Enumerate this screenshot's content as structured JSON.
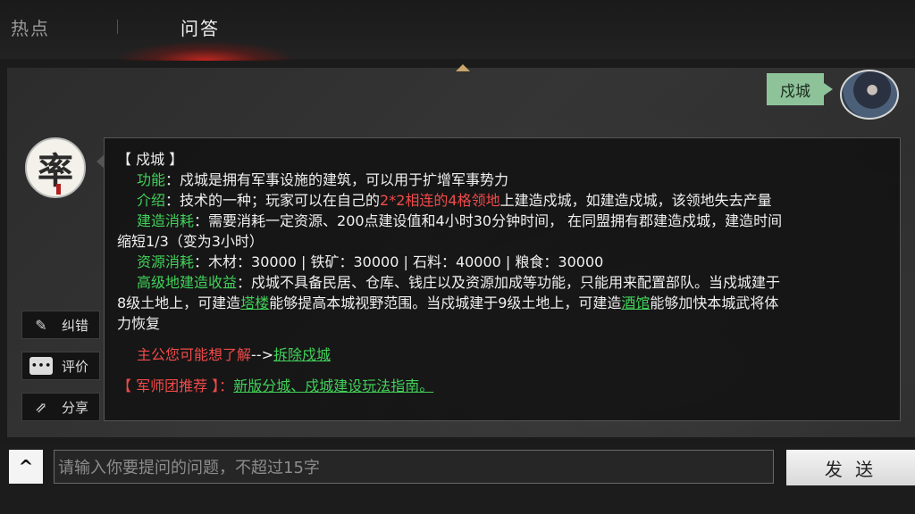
{
  "tabs": {
    "hot": "热点",
    "qa": "问答"
  },
  "question": {
    "text": "戍城"
  },
  "bot": {
    "avatar_char": "率"
  },
  "side_buttons": {
    "fix": "纠错",
    "rate": "评价",
    "share": "分享"
  },
  "answer": {
    "title": "【 戍城 】",
    "func_label": "功能",
    "func_text": "：戍城是拥有军事设施的建筑，可以用于扩增军事势力",
    "intro_label": "介绍",
    "intro_a": "：技术的一种；玩家可以在自己的",
    "intro_red": "2*2相连的4格领地",
    "intro_b": "上建造戍城，如建造戍城，该领地失去产量",
    "build_label": "建造消耗",
    "build_text": "：需要消耗一定资源、200点建设值和4小时30分钟时间，  在同盟拥有郡建造戍城，建造时间",
    "build_text2": "缩短1/3（变为3小时）",
    "res_label": "资源消耗",
    "res_text": "：木材：30000 | 铁矿：30000 | 石料：40000 | 粮食：30000",
    "adv_label": "高级地建造收益",
    "adv_text": "：戍城不具备民居、仓库、钱庄以及资源加成等功能，只能用来配置部队。当戍城建于",
    "adv_line2_a": "8级土地上，可建造",
    "adv_link1": "塔楼",
    "adv_line2_b": "能够提高本城视野范围。当戍城建于9级土地上，可建造",
    "adv_link2": "酒馆",
    "adv_line2_c": "能够加快本城武将体",
    "adv_line3": "力恢复",
    "related_prefix": "主公您可能想了解",
    "related_arrow": "-->",
    "related_link": "拆除戍城",
    "rec_prefix": "【 军师团推荐 】：",
    "rec_link": "新版分城、戍城建设玩法指南。"
  },
  "input": {
    "placeholder": "请输入你要提问的问题，不超过15字"
  },
  "send_label": "发 送",
  "collapse_glyph": "^"
}
